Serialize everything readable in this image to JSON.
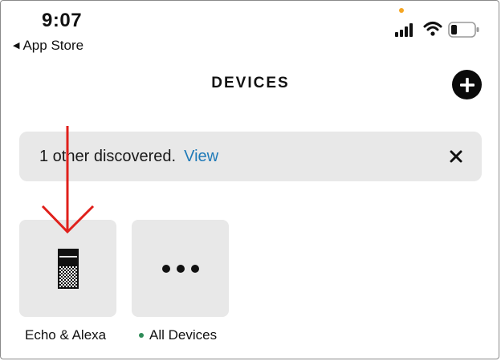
{
  "status_bar": {
    "time": "9:07",
    "back_label": "App Store",
    "icons": [
      "cellular-signal-icon",
      "wifi-icon",
      "battery-icon"
    ]
  },
  "header": {
    "title": "DEVICES",
    "add_icon": "plus-circle-icon"
  },
  "banner": {
    "text": "1 other discovered.",
    "link": "View",
    "close_icon": "close-icon"
  },
  "tiles": [
    {
      "label": "Echo & Alexa",
      "icon": "echo-device-icon"
    },
    {
      "label": "All Devices",
      "icon": "more-dots-icon",
      "status_dot": true
    }
  ],
  "colors": {
    "link": "#1f7ab8",
    "tile_bg": "#e8e8e8",
    "annotation": "#e0201b",
    "status_dot": "#2e8b57",
    "orange_indicator": "#f5a623"
  }
}
